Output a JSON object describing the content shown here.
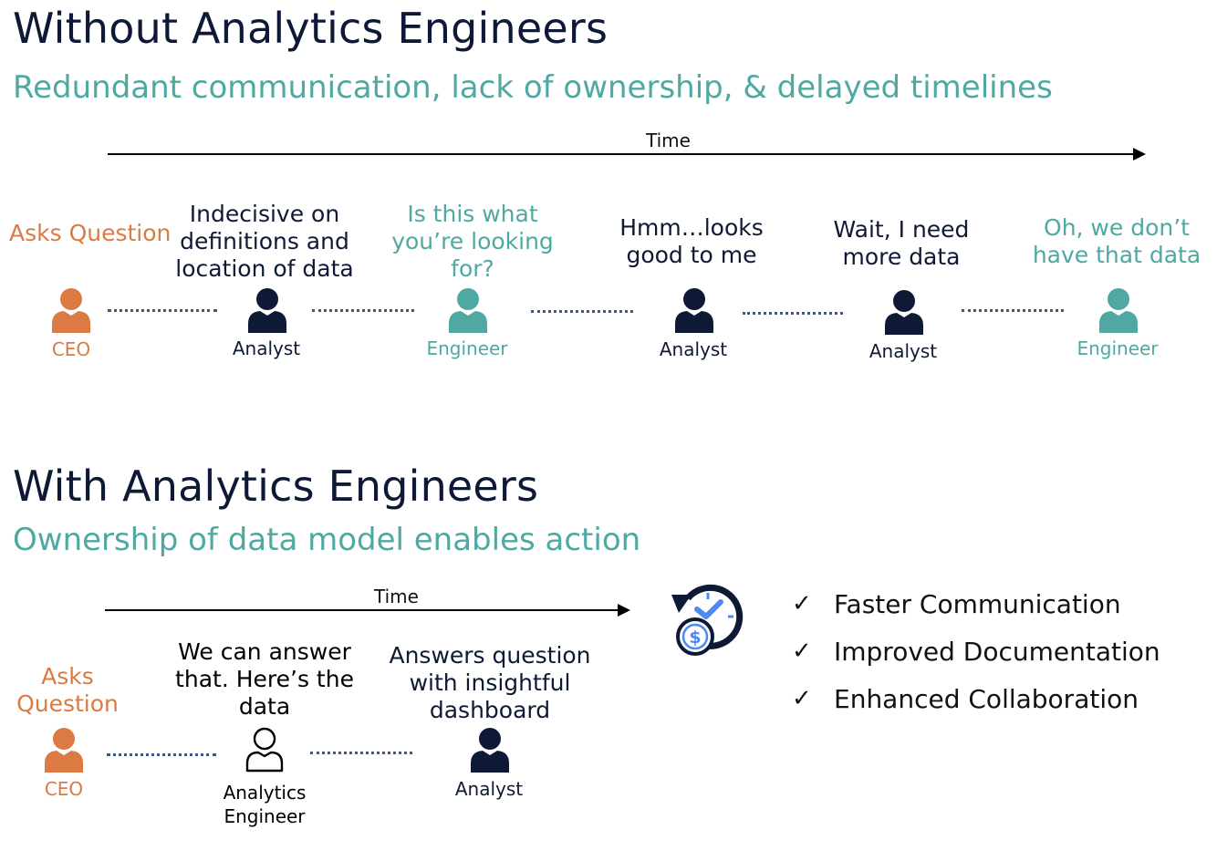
{
  "colors": {
    "ceo": "#dc7a44",
    "engineer": "#4fa9a2",
    "analyst": "#0e1a35",
    "connector": "#3c5b7a",
    "icon_accent": "#4c8bf5"
  },
  "without": {
    "title": "Without Analytics Engineers",
    "subtitle": "Redundant communication, lack of ownership, & delayed timelines",
    "time_label": "Time",
    "steps": [
      {
        "caption": "Asks Question",
        "role": "CEO",
        "kind": "ceo"
      },
      {
        "caption": "Indecisive on definitions and location of data",
        "role": "Analyst",
        "kind": "analyst"
      },
      {
        "caption": "Is this what you’re looking for?",
        "role": "Engineer",
        "kind": "engineer"
      },
      {
        "caption": "Hmm…looks good to me",
        "role": "Analyst",
        "kind": "analyst"
      },
      {
        "caption": "Wait, I need more data",
        "role": "Analyst",
        "kind": "analyst"
      },
      {
        "caption": "Oh, we don’t have that data",
        "role": "Engineer",
        "kind": "engineer"
      }
    ]
  },
  "with": {
    "title": "With Analytics Engineers",
    "subtitle": "Ownership of data model enables action",
    "time_label": "Time",
    "steps": [
      {
        "caption": "Asks Question",
        "role": "CEO",
        "kind": "ceo"
      },
      {
        "caption": "We can answer that. Here’s the data",
        "role": "Analytics Engineer",
        "kind": "analytics-engineer"
      },
      {
        "caption": "Answers question with insightful dashboard",
        "role": "Analyst",
        "kind": "analyst"
      }
    ],
    "icon": "time-money-icon",
    "benefits": [
      "Faster Communication",
      "Improved Documentation",
      "Enhanced Collaboration"
    ],
    "check_symbol": "✓"
  }
}
